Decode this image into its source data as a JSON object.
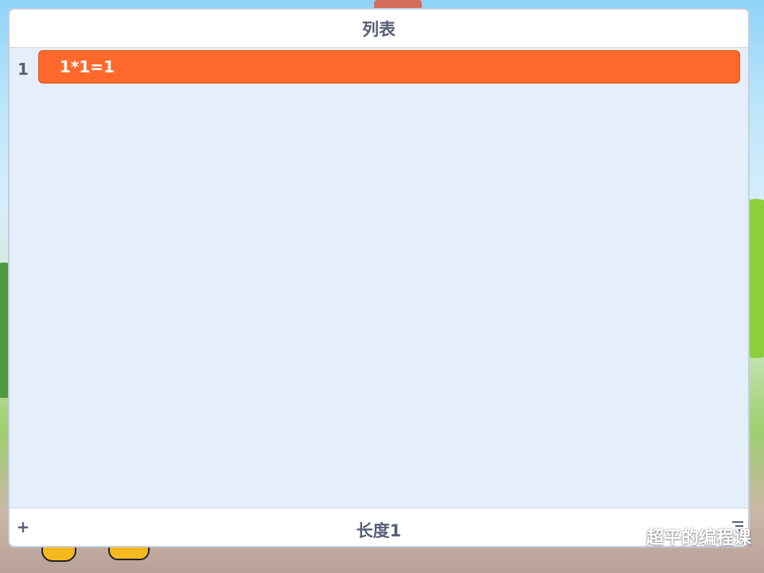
{
  "list": {
    "title": "列表",
    "items": [
      {
        "index": "1",
        "value": "1*1=1"
      }
    ],
    "add_label": "+",
    "length_label": "长度1"
  },
  "watermark": {
    "text": "超平的编程课",
    "icon": "wechat-icon"
  },
  "colors": {
    "item_fill": "#ff6a2c",
    "panel_bg": "#e5effc",
    "text": "#575e75"
  }
}
